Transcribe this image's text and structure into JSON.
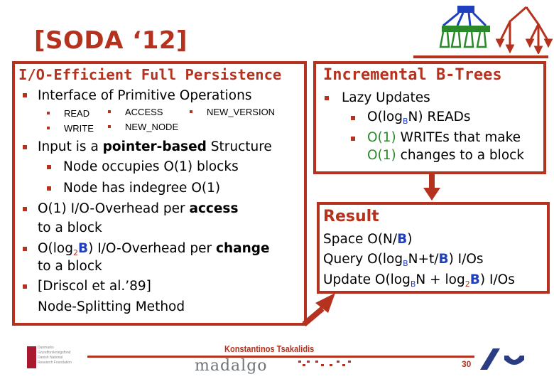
{
  "slide_title": "[SODA ‘12]",
  "left_box": {
    "heading": "I/O-Efficient Full Persistence",
    "items": [
      {
        "text": "Interface of Primitive Operations"
      },
      {
        "text_pre": "Input is a ",
        "text_bold": "pointer-based",
        "text_post": " Structure"
      },
      {
        "text": "Node occupies O(1) blocks"
      },
      {
        "text": "Node has indegree O(1)"
      },
      {
        "text_pre": "O(1) I/O-Overhead per ",
        "text_bold": "access",
        "text2": "to a block"
      },
      {
        "text_pre": "O(log",
        "sub": "2",
        "blue": "B",
        "text_mid": ") I/O-Overhead per ",
        "text_bold": "change",
        "text2": "to a block"
      },
      {
        "text": "[Driscol et al.’89]",
        "text2": "Node-Splitting Method"
      }
    ],
    "operations": [
      "READ",
      "WRITE",
      "ACCESS",
      "NEW_NODE",
      "NEW_VERSION"
    ]
  },
  "inc_box": {
    "heading": "Incremental B-Trees",
    "item1": "Lazy Updates",
    "reads_pre": "O(log",
    "reads_sub": "B",
    "reads_post": "N) READs",
    "writes_green": "O(1)",
    "writes_post": " WRITEs that make",
    "changes_green": "O(1)",
    "changes_post": " changes to a block"
  },
  "result_box": {
    "heading": "Result",
    "space_pre": "Space O(N/",
    "space_B": "B",
    "space_post": ")",
    "query_pre": "Query O(log",
    "query_sub": "B",
    "query_mid": "N+t/",
    "query_B": "B",
    "query_post": ") I/Os",
    "update_pre": "Update O(log",
    "update_sub": "B",
    "update_mid": "N + log",
    "update_sub2": "2",
    "update_B": "B",
    "update_post": ") I/Os"
  },
  "footer": {
    "author": "Konstantinos Tsakalidis",
    "brand": "madalgo",
    "page_number": "30",
    "foundation_lines": [
      "Danmarks",
      "Grundforskningsfond",
      "Danish National",
      "Research Foundation"
    ]
  },
  "colors": {
    "accent": "#b5321f",
    "blue": "#1f3fbf",
    "green": "#2a8a2a"
  }
}
